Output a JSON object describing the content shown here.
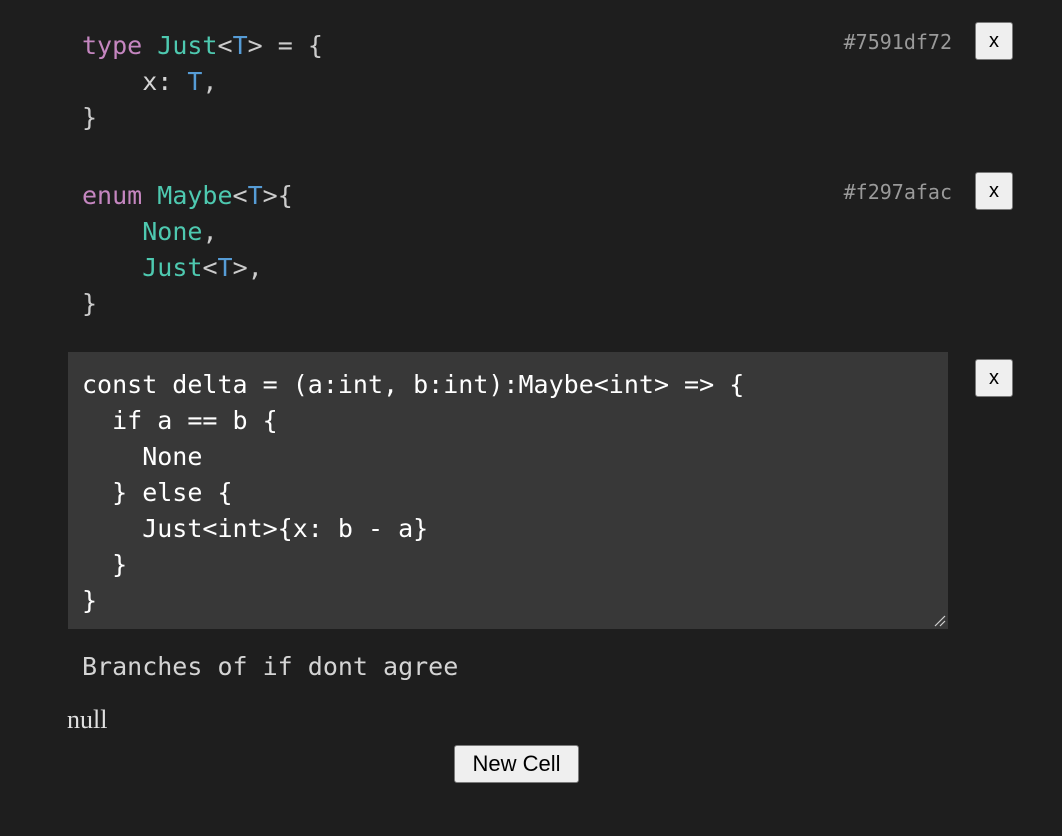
{
  "cells": [
    {
      "hash": "#7591df72",
      "close_label": "x",
      "tokens": {
        "l1_kw": "type",
        "l1_name": "Just",
        "l1_lt": "<",
        "l1_tp": "T",
        "l1_rest": "> = {",
        "l2_field": "    x: ",
        "l2_tp": "T",
        "l2_rest": ",",
        "l3": "}"
      }
    },
    {
      "hash": "#f297afac",
      "close_label": "x",
      "tokens": {
        "l1_kw": "enum",
        "l1_name": "Maybe",
        "l1_lt": "<",
        "l1_tp": "T",
        "l1_rest": ">{",
        "l2_variant": "None",
        "l2_rest": ",",
        "l3_variant": "Just",
        "l3_lt": "<",
        "l3_tp": "T",
        "l3_rest": ">,",
        "l4": "}"
      }
    },
    {
      "close_label": "x",
      "code_lines": [
        "const delta = (a:int, b:int):Maybe<int> => {",
        "  if a == b {",
        "    None",
        "  } else {",
        "    Just<int>{x: b - a}",
        "  }",
        "}"
      ],
      "error": "Branches of if dont agree",
      "result": "null"
    }
  ],
  "new_cell_label": "New Cell",
  "colors": {
    "background": "#1e1e1e",
    "editor_background": "#383838",
    "keyword": "#c586c0",
    "type_name": "#4ec9b0",
    "type_param": "#569cd6",
    "hash_text": "#9a9a9a"
  }
}
